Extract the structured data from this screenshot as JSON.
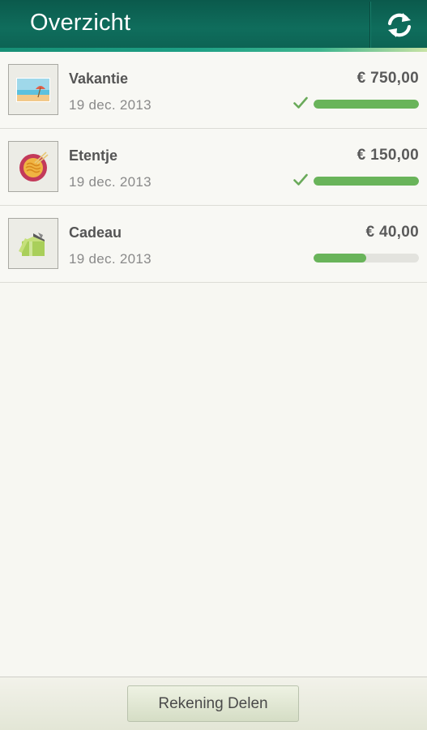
{
  "header": {
    "title": "Overzicht",
    "refresh_icon": "refresh-icon"
  },
  "items": [
    {
      "title": "Vakantie",
      "date": "19 dec. 2013",
      "amount": "€ 750,00",
      "icon": "beach-icon",
      "progress": 1.0,
      "completed": true
    },
    {
      "title": "Etentje",
      "date": "19 dec. 2013",
      "amount": "€ 150,00",
      "icon": "noodle-bowl-icon",
      "progress": 1.0,
      "completed": true
    },
    {
      "title": "Cadeau",
      "date": "19 dec. 2013",
      "amount": "€ 40,00",
      "icon": "gift-icon",
      "progress": 0.5,
      "completed": false
    }
  ],
  "footer": {
    "button_label": "Rekening Delen"
  },
  "colors": {
    "header": "#0f6d5c",
    "progress_fill": "#69b45a",
    "progress_track": "#e3e3de",
    "check": "#6aaa5a"
  }
}
